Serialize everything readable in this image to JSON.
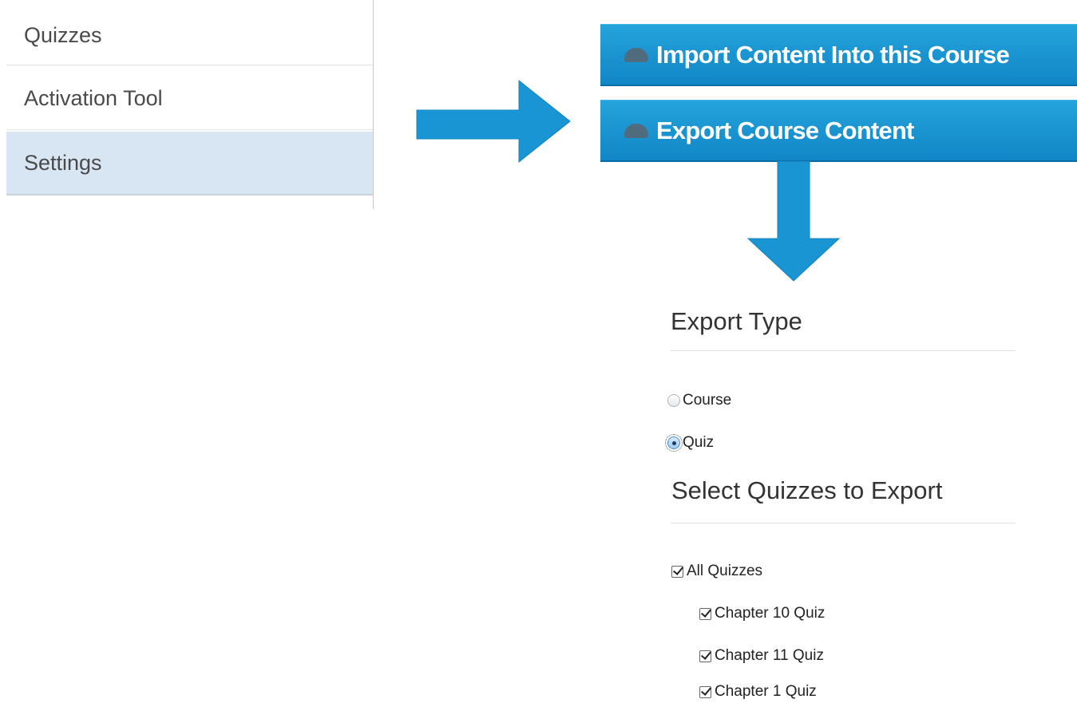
{
  "nav": {
    "items": [
      {
        "label": "Quizzes",
        "selected": false
      },
      {
        "label": "Activation Tool",
        "selected": false
      },
      {
        "label": "Settings",
        "selected": true
      }
    ]
  },
  "buttons": {
    "import_label": "Import Content Into this Course",
    "export_label": "Export Course Content"
  },
  "export": {
    "heading": "Export Type",
    "options": [
      {
        "label": "Course",
        "checked": false
      },
      {
        "label": "Quiz",
        "checked": true
      }
    ],
    "select_heading": "Select Quizzes to Export",
    "all_label": "All Quizzes",
    "quizzes": [
      {
        "label": "Chapter 10 Quiz",
        "checked": true
      },
      {
        "label": "Chapter 11 Quiz",
        "checked": true
      },
      {
        "label": "Chapter 1 Quiz",
        "checked": true
      }
    ]
  },
  "colors": {
    "accent": "#1a95d3",
    "selected_nav": "#d8e6f4"
  }
}
